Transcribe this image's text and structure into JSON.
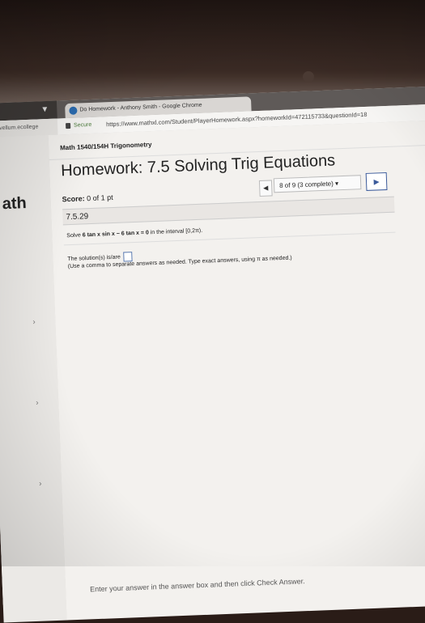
{
  "browser": {
    "tab_title": "Do Homework - Anthony Smith - Google Chrome",
    "left_address_fragment": "vellum.ecollege",
    "secure_label": "Secure",
    "url": "https://www.mathxl.com/Student/PlayerHomework.aspx?homeworkId=472115733&questionId=18"
  },
  "sidebar": {
    "title": "ath"
  },
  "header": {
    "course": "Math 1540/154H Trigonometry",
    "homework_title": "Homework: 7.5 Solving Trig Equations",
    "score_label": "Score:",
    "score_value": "0 of 1 pt"
  },
  "navigation": {
    "prev_icon": "triangle-left-icon",
    "question_selector": "8 of 9 (3 complete)",
    "next_icon": "triangle-right-icon"
  },
  "question": {
    "id": "7.5.29",
    "prompt_prefix": "Solve",
    "prompt_equation": "6 tan x sin x − 6 tan x = 0",
    "prompt_suffix": "in the interval [0,2π).",
    "solution_label": "The solution(s) is/are",
    "hint": "(Use a comma to separate answers as needed. Type exact answers, using π as needed.)"
  },
  "footer": {
    "instruction": "Enter your answer in the answer box and then click Check Answer."
  }
}
